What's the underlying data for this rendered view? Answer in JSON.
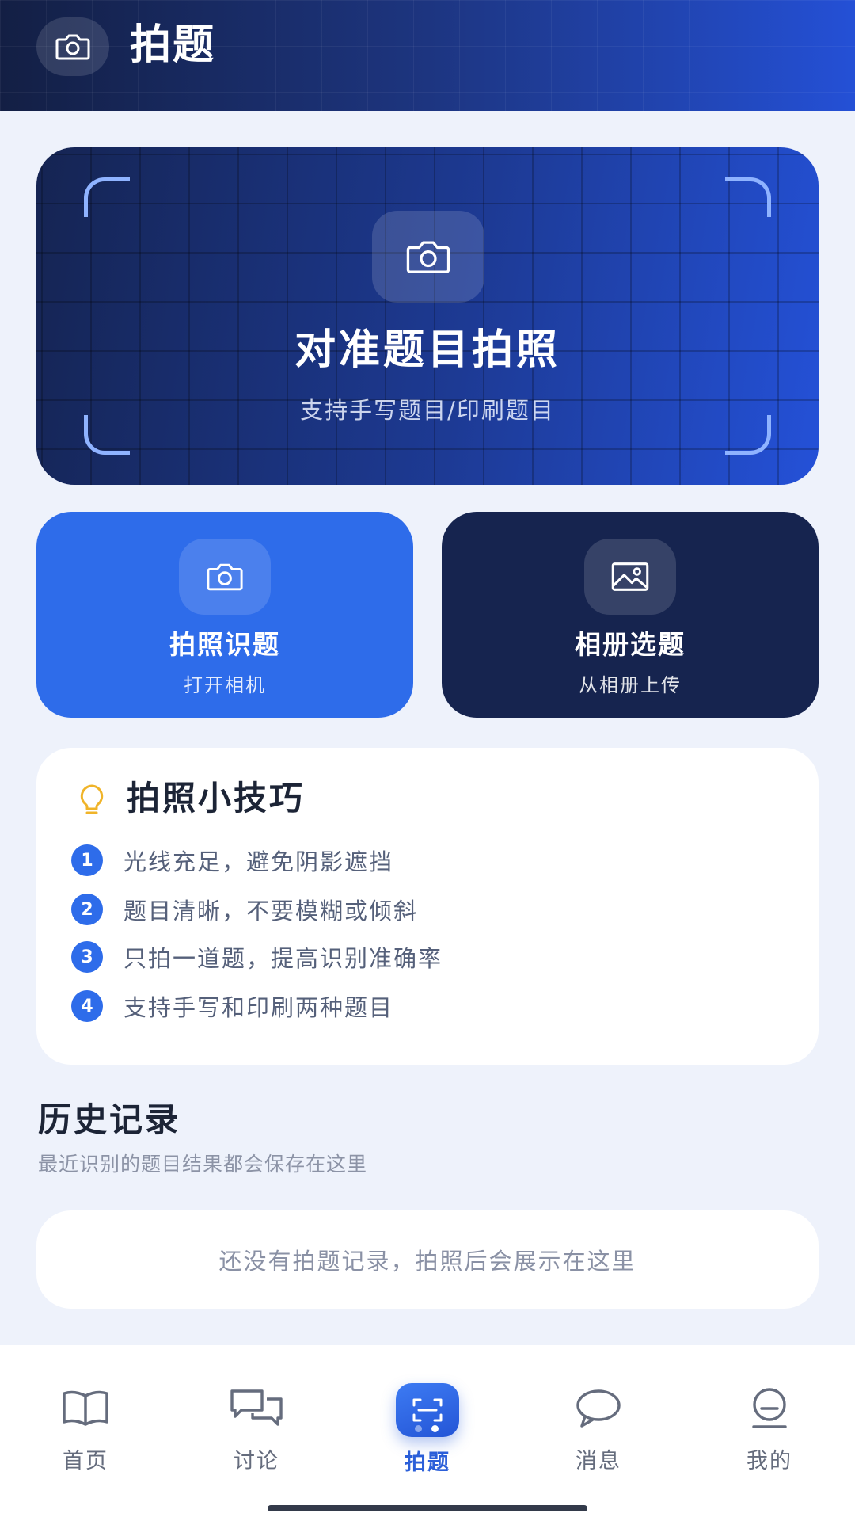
{
  "header": {
    "title": "拍题",
    "icon": "camera-icon"
  },
  "hero": {
    "title": "对准题目拍照",
    "subtitle": "支持手写题目/印刷题目",
    "icon": "camera-icon"
  },
  "actions": {
    "camera": {
      "title": "拍照识题",
      "subtitle": "打开相机",
      "icon": "camera-icon"
    },
    "album": {
      "title": "相册选题",
      "subtitle": "从相册上传",
      "icon": "image-icon"
    }
  },
  "tips": {
    "title": "拍照小技巧",
    "icon": "lightbulb-icon",
    "items": [
      {
        "num": "1",
        "text": "光线充足，避免阴影遮挡"
      },
      {
        "num": "2",
        "text": "题目清晰，不要模糊或倾斜"
      },
      {
        "num": "3",
        "text": "只拍一道题，提高识别准确率"
      },
      {
        "num": "4",
        "text": "支持手写和印刷两种题目"
      }
    ]
  },
  "history": {
    "title": "历史记录",
    "subtitle": "最近识别的题目结果都会保存在这里",
    "empty": "还没有拍题记录，拍照后会展示在这里"
  },
  "nav": {
    "items": [
      {
        "label": "首页",
        "icon": "book-icon"
      },
      {
        "label": "讨论",
        "icon": "chat-bubbles-icon"
      },
      {
        "label": "拍题",
        "icon": "scan-icon",
        "active": true
      },
      {
        "label": "消息",
        "icon": "message-icon"
      },
      {
        "label": "我的",
        "icon": "profile-icon"
      }
    ]
  },
  "colors": {
    "accent": "#2e6cea",
    "dark_card": "#16244f",
    "page_bg": "#eef2fb",
    "active_nav": "#2b5fd9"
  }
}
